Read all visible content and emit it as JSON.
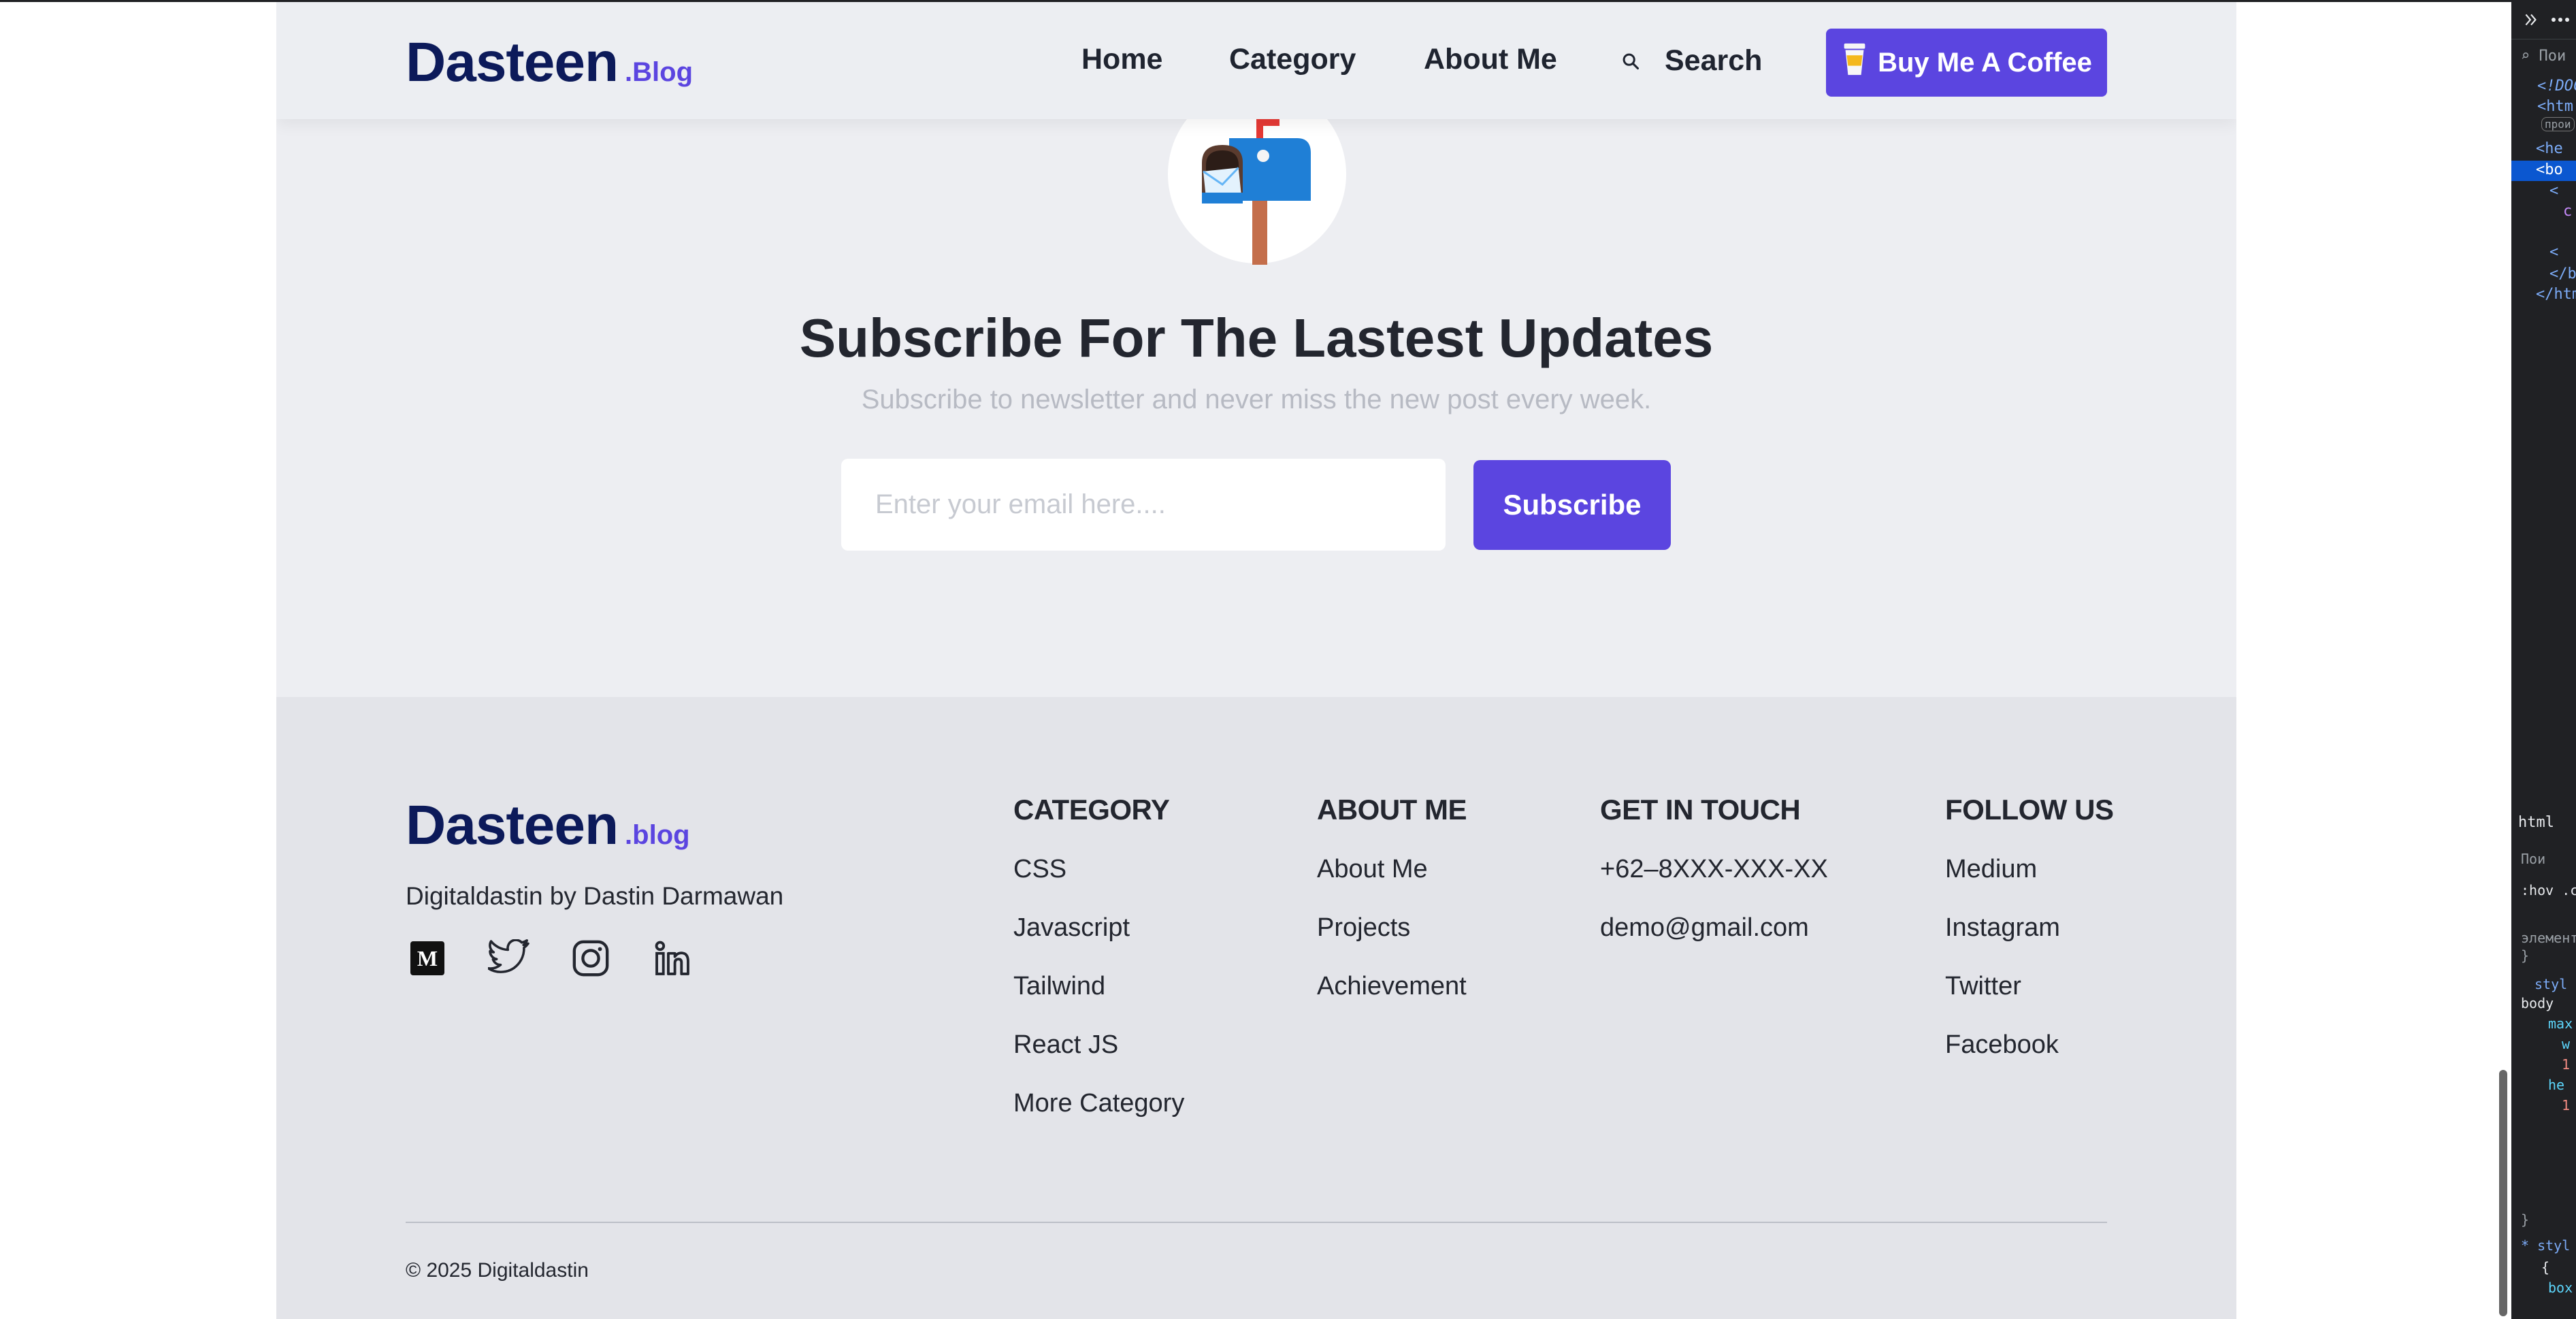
{
  "header": {
    "logo_main": "Dasteen",
    "logo_sub": ".Blog",
    "nav": [
      "Home",
      "Category",
      "About Me"
    ],
    "search_label": "Search",
    "coffee_button": "Buy Me A Coffee"
  },
  "subscribe": {
    "title": "Subscribe For The Lastest Updates",
    "description": "Subscribe to newsletter and never miss the new post every week.",
    "email_placeholder": "Enter your email here....",
    "button": "Subscribe"
  },
  "footer": {
    "logo_main": "Dasteen",
    "logo_sub": ".blog",
    "tagline": "Digitaldastin by Dastin Darmawan",
    "socials": [
      "medium-icon",
      "twitter-icon",
      "instagram-icon",
      "linkedin-icon"
    ],
    "columns": [
      {
        "title": "CATEGORY",
        "links": [
          "CSS",
          "Javascript",
          "Tailwind",
          "React JS",
          "More Category"
        ]
      },
      {
        "title": "ABOUT ME",
        "links": [
          "About Me",
          "Projects",
          "Achievement"
        ]
      },
      {
        "title": "GET IN TOUCH",
        "links": [
          "+62–8XXX-XXX-XX",
          "demo@gmail.com"
        ]
      },
      {
        "title": "FOLLOW US",
        "links": [
          "Medium",
          "Instagram",
          "Twitter",
          "Facebook"
        ]
      }
    ],
    "copyright": "© 2025 Digitaldastin"
  },
  "devtools": {
    "lines": [
      "<!DOC",
      "<htm",
      "прои",
      "<he",
      "<bo",
      "<",
      "c",
      "<",
      "</b",
      "</htm"
    ],
    "breadcrumb": "html",
    "filter": "Пои",
    "hov": ":hov .c",
    "styles_lines": [
      "элемент",
      "}",
      "styl",
      "body",
      "max",
      "w",
      "1",
      "he",
      "1",
      "}",
      "* styl",
      "{",
      "box"
    ]
  },
  "colors": {
    "accent": "#5b45e0",
    "logo": "#0c1a5a",
    "page_bg": "#edeef2",
    "footer_bg": "#e3e4e9"
  }
}
